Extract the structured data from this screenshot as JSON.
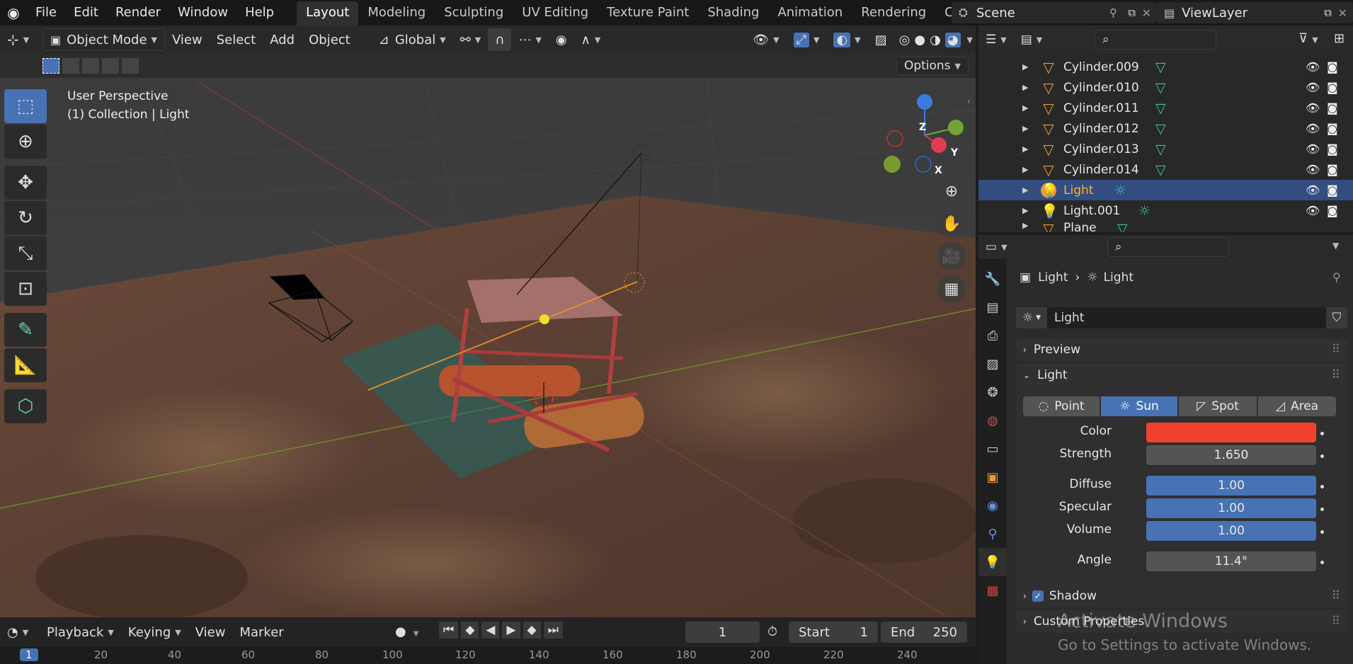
{
  "menubar": {
    "menus": [
      "File",
      "Edit",
      "Render",
      "Window",
      "Help"
    ],
    "workspaces": [
      "Layout",
      "Modeling",
      "Sculpting",
      "UV Editing",
      "Texture Paint",
      "Shading",
      "Animation",
      "Rendering",
      "Compositin"
    ],
    "scene": "Scene",
    "view_layer": "ViewLayer"
  },
  "viewport": {
    "mode": "Object Mode",
    "menus": [
      "View",
      "Select",
      "Add",
      "Object"
    ],
    "orientation": "Global",
    "options": "Options",
    "overlay_line1": "User Perspective",
    "overlay_line2": "(1) Collection | Light",
    "axes": {
      "z": "Z",
      "y": "Y",
      "x": "X"
    }
  },
  "outliner": {
    "rows": [
      {
        "name": "Cylinder.009",
        "type": "mesh",
        "selected": false
      },
      {
        "name": "Cylinder.010",
        "type": "mesh",
        "selected": false
      },
      {
        "name": "Cylinder.011",
        "type": "mesh",
        "selected": false
      },
      {
        "name": "Cylinder.012",
        "type": "mesh",
        "selected": false
      },
      {
        "name": "Cylinder.013",
        "type": "mesh",
        "selected": false
      },
      {
        "name": "Cylinder.014",
        "type": "mesh",
        "selected": false
      },
      {
        "name": "Light",
        "type": "light",
        "selected": true
      },
      {
        "name": "Light.001",
        "type": "light",
        "selected": false
      },
      {
        "name": "Plane",
        "type": "mesh",
        "selected": false
      }
    ]
  },
  "properties": {
    "breadcrumb_object": "Light",
    "breadcrumb_data": "Light",
    "datablock": "Light",
    "preview_label": "Preview",
    "light_label": "Light",
    "types": [
      "Point",
      "Sun",
      "Spot",
      "Area"
    ],
    "active_type": "Sun",
    "color_label": "Color",
    "color_value": "#f0412f",
    "strength_label": "Strength",
    "strength": "1.650",
    "diffuse_label": "Diffuse",
    "diffuse": "1.00",
    "specular_label": "Specular",
    "specular": "1.00",
    "volume_label": "Volume",
    "volume": "1.00",
    "angle_label": "Angle",
    "angle": "11.4°",
    "shadow_label": "Shadow",
    "custom_label": "Custom Properties"
  },
  "timeline": {
    "menus": [
      "Playback",
      "Keying",
      "View",
      "Marker"
    ],
    "current_frame": "1",
    "start_label": "Start",
    "start": "1",
    "end_label": "End",
    "end": "250",
    "ruler": [
      "1",
      "20",
      "40",
      "60",
      "80",
      "100",
      "120",
      "140",
      "160",
      "180",
      "200",
      "220",
      "240"
    ]
  },
  "watermark": {
    "line1": "Activate Windows",
    "line2": "Go to Settings to activate Windows."
  }
}
